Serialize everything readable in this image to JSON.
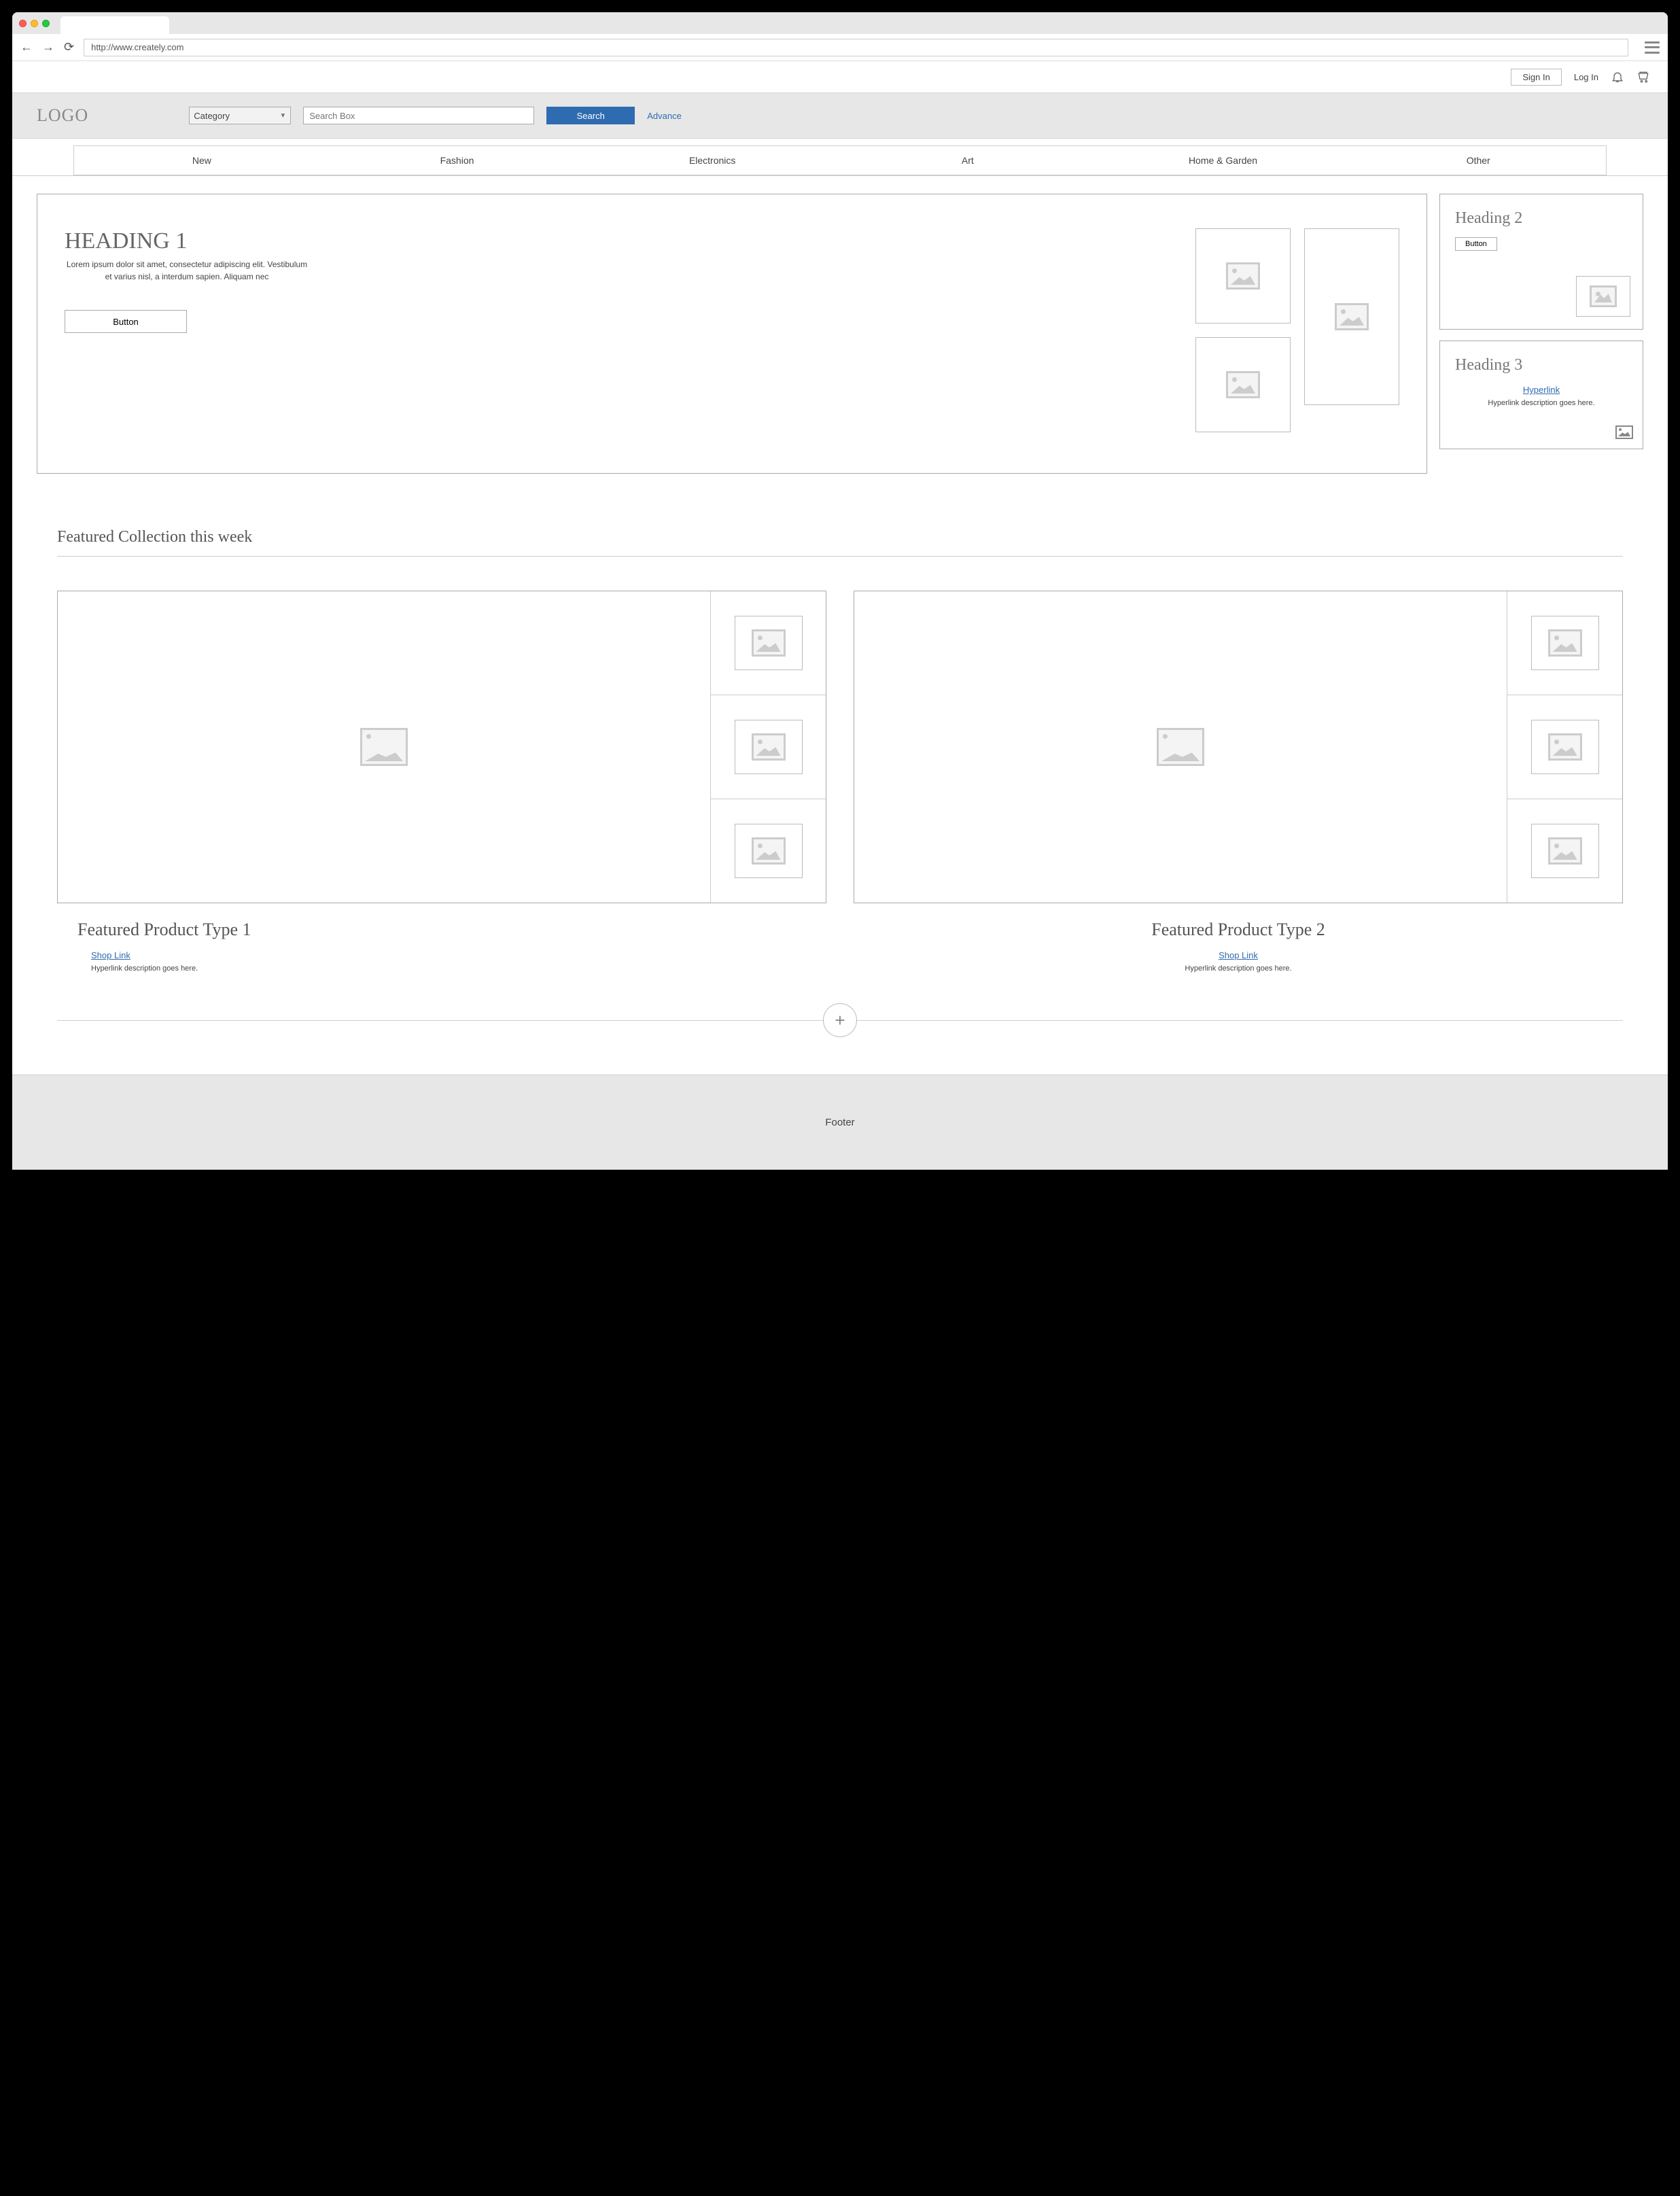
{
  "browser": {
    "url": "http://www.creately.com"
  },
  "account": {
    "sign_in": "Sign In",
    "log_in": "Log In"
  },
  "header": {
    "logo": "LOGO",
    "category_label": "Category",
    "search_placeholder": "Search Box",
    "search_button": "Search",
    "advance": "Advance"
  },
  "nav": {
    "items": [
      "New",
      "Fashion",
      "Electronics",
      "Art",
      "Home & Garden",
      "Other"
    ]
  },
  "hero": {
    "heading": "HEADING 1",
    "body": "Lorem ipsum dolor sit amet, consectetur adipiscing elit. Vestibulum et varius nisl, a interdum sapien. Aliquam nec",
    "button": "Button"
  },
  "side": {
    "box1": {
      "heading": "Heading 2",
      "button": "Button"
    },
    "box2": {
      "heading": "Heading 3",
      "link": "Hyperlink",
      "desc": "Hyperlink description goes here."
    }
  },
  "featured": {
    "section_title": "Featured Collection this week",
    "card1": {
      "title": "Featured Product Type  1",
      "link": "Shop Link",
      "desc": "Hyperlink description goes here."
    },
    "card2": {
      "title": "Featured Product Type  2",
      "link": "Shop Link",
      "desc": "Hyperlink description goes here."
    }
  },
  "footer": {
    "text": "Footer"
  }
}
